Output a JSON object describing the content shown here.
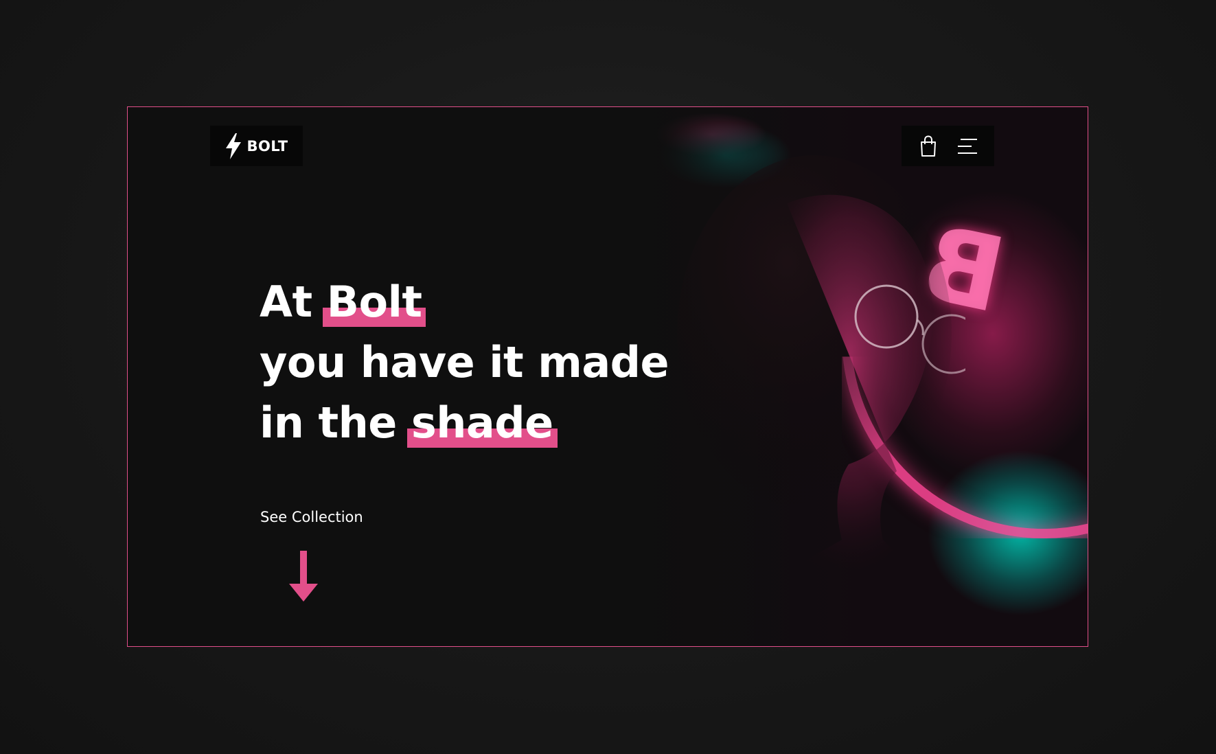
{
  "brand": {
    "name": "BOLT",
    "logo_icon": "lightning-bolt-icon"
  },
  "nav": {
    "cart_icon": "shopping-bag-icon",
    "menu_icon": "hamburger-menu-icon"
  },
  "hero": {
    "line1_prefix": "At ",
    "line1_highlight": "Bolt",
    "line2": "you have it made",
    "line3_prefix": "in the ",
    "line3_highlight": "shade",
    "cta_label": "See Collection",
    "scroll_icon": "arrow-down-icon",
    "image": "woman-neon-portrait"
  },
  "colors": {
    "accent": "#e24f8a",
    "background": "#0f0f0f",
    "page_bg": "#1a1a1a",
    "text": "#ffffff",
    "neon_teal": "#00d2be"
  }
}
